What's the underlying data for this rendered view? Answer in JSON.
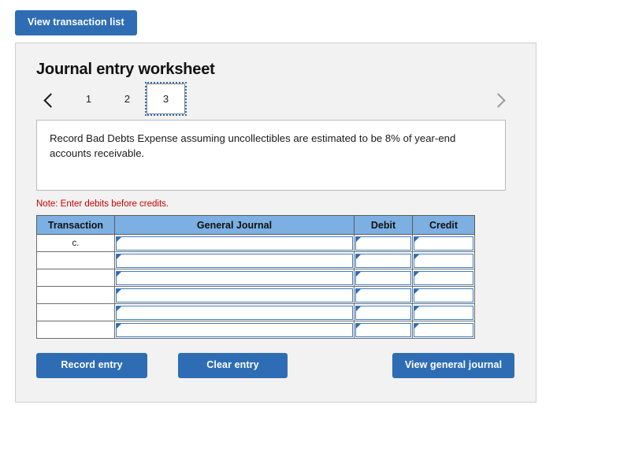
{
  "top": {
    "view_transaction_list_label": "View transaction list"
  },
  "worksheet": {
    "title": "Journal entry worksheet",
    "pager": {
      "prev_icon": "chevron-left-icon",
      "next_icon": "chevron-right-icon",
      "tabs": [
        {
          "label": "1",
          "active": false
        },
        {
          "label": "2",
          "active": false
        },
        {
          "label": "3",
          "active": true
        }
      ]
    },
    "instruction": "Record Bad Debts Expense assuming uncollectibles are estimated to be 8% of year-end accounts receivable.",
    "note": "Note: Enter debits before credits."
  },
  "table": {
    "headers": [
      "Transaction",
      "General Journal",
      "Debit",
      "Credit"
    ],
    "rows": [
      {
        "transaction": "c.",
        "general_journal": "",
        "debit": "",
        "credit": ""
      },
      {
        "transaction": "",
        "general_journal": "",
        "debit": "",
        "credit": ""
      },
      {
        "transaction": "",
        "general_journal": "",
        "debit": "",
        "credit": ""
      },
      {
        "transaction": "",
        "general_journal": "",
        "debit": "",
        "credit": ""
      },
      {
        "transaction": "",
        "general_journal": "",
        "debit": "",
        "credit": ""
      },
      {
        "transaction": "",
        "general_journal": "",
        "debit": "",
        "credit": ""
      }
    ]
  },
  "footer": {
    "record_entry_label": "Record entry",
    "clear_entry_label": "Clear entry",
    "view_general_journal_label": "View general journal"
  },
  "colors": {
    "button_blue": "#2e6db4",
    "header_blue": "#7cafe2",
    "panel_bg": "#f2f2f2",
    "note_red": "#cc0000",
    "cell_border_blue": "#3f7cbf"
  }
}
